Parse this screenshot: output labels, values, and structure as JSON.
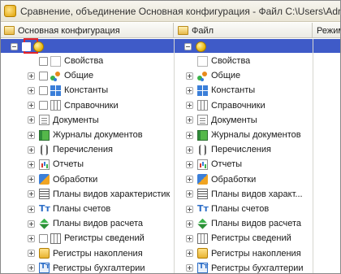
{
  "window": {
    "title": "Сравнение, объединение Основная конфигурация - Файл C:\\Users\\Adr"
  },
  "columns": [
    {
      "label": "Основная конфигурация"
    },
    {
      "label": "Файл"
    },
    {
      "label": "Режим"
    }
  ],
  "colors": {
    "selection": "#3f5bc8",
    "highlight_frame": "#e3232b"
  },
  "tree": {
    "root": {
      "left_label": "",
      "right_label": ""
    },
    "items": [
      {
        "icon": "properties-icon",
        "left": "Свойства",
        "right": "Свойства",
        "left_checkbox": true,
        "left_expander": false,
        "right_expander": false
      },
      {
        "icon": "common-icon",
        "left": "Общие",
        "right": "Общие",
        "left_checkbox": true,
        "left_expander": true,
        "right_expander": true
      },
      {
        "icon": "constants-icon",
        "left": "Константы",
        "right": "Константы",
        "left_checkbox": true,
        "left_expander": true,
        "right_expander": true
      },
      {
        "icon": "catalogs-icon",
        "left": "Справочники",
        "right": "Справочники",
        "left_checkbox": true,
        "left_expander": true,
        "right_expander": true
      },
      {
        "icon": "documents-icon",
        "left": "Документы",
        "right": "Документы",
        "left_checkbox": false,
        "left_expander": true,
        "right_expander": true
      },
      {
        "icon": "document-journals-icon",
        "left": "Журналы документов",
        "right": "Журналы документов",
        "left_checkbox": false,
        "left_expander": true,
        "right_expander": true
      },
      {
        "icon": "enumerations-icon",
        "left": "Перечисления",
        "right": "Перечисления",
        "left_checkbox": false,
        "left_expander": true,
        "right_expander": true
      },
      {
        "icon": "reports-icon",
        "left": "Отчеты",
        "right": "Отчеты",
        "left_checkbox": false,
        "left_expander": true,
        "right_expander": true
      },
      {
        "icon": "data-processors-icon",
        "left": "Обработки",
        "right": "Обработки",
        "left_checkbox": false,
        "left_expander": true,
        "right_expander": true
      },
      {
        "icon": "characteristic-types-icon",
        "left": "Планы видов характеристик",
        "right": "Планы видов характ...",
        "left_checkbox": false,
        "left_expander": true,
        "right_expander": true
      },
      {
        "icon": "charts-of-accounts-icon",
        "left": "Планы счетов",
        "right": "Планы счетов",
        "left_checkbox": false,
        "left_expander": true,
        "right_expander": true
      },
      {
        "icon": "calculation-types-icon",
        "left": "Планы видов расчета",
        "right": "Планы видов расчета",
        "left_checkbox": false,
        "left_expander": true,
        "right_expander": true
      },
      {
        "icon": "information-registers-icon",
        "left": "Регистры сведений",
        "right": "Регистры сведений",
        "left_checkbox": true,
        "left_expander": true,
        "right_expander": true
      },
      {
        "icon": "accumulation-registers-icon",
        "left": "Регистры накопления",
        "right": "Регистры накопления",
        "left_checkbox": false,
        "left_expander": true,
        "right_expander": true
      },
      {
        "icon": "accounting-registers-icon",
        "left": "Регистры бухгалтерии",
        "right": "Регистры бухгалтерии",
        "left_checkbox": false,
        "left_expander": true,
        "right_expander": true
      }
    ]
  }
}
